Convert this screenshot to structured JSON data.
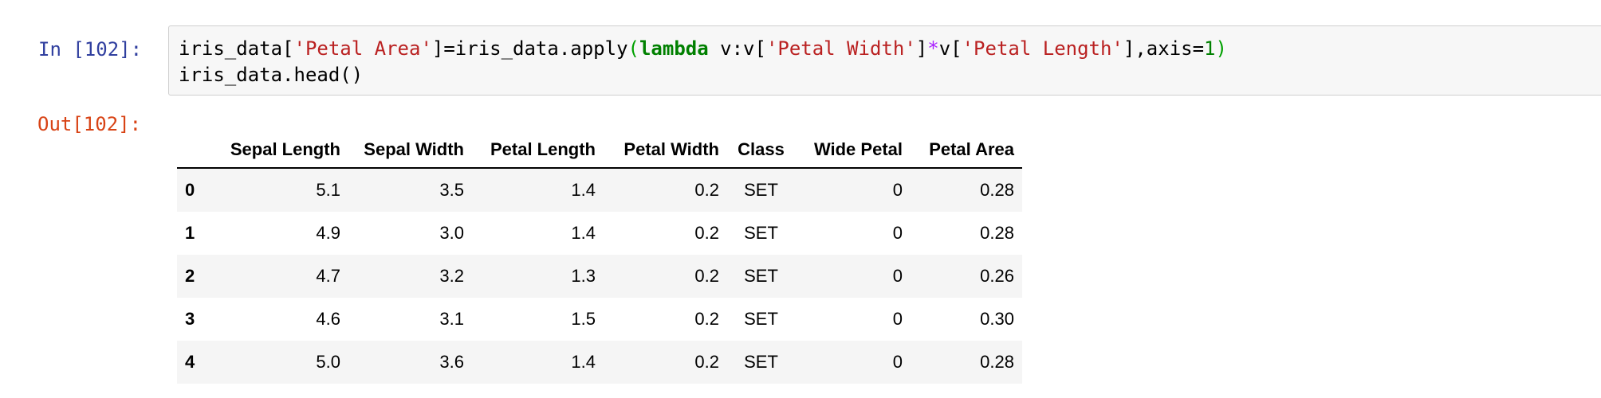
{
  "input_cell": {
    "prompt": "In [102]:",
    "code": {
      "line1": {
        "t1": "iris_data[",
        "s1": "'Petal Area'",
        "t2": "]=iris_data.apply",
        "p1": "(",
        "kw": "lambda",
        "t3": " v:v[",
        "s2": "'Petal Width'",
        "t4": "]",
        "op": "*",
        "t5": "v[",
        "s3": "'Petal Length'",
        "t6": "],axis=",
        "n1": "1",
        "p2": ")"
      },
      "line2": "iris_data.head()"
    }
  },
  "output_cell": {
    "prompt": "Out[102]:",
    "table": {
      "index_header": "",
      "columns": [
        "Sepal Length",
        "Sepal Width",
        "Petal Length",
        "Petal Width",
        "Class",
        "Wide Petal",
        "Petal Area"
      ],
      "rows": [
        {
          "index": "0",
          "values": [
            "5.1",
            "3.5",
            "1.4",
            "0.2",
            "SET",
            "0",
            "0.28"
          ]
        },
        {
          "index": "1",
          "values": [
            "4.9",
            "3.0",
            "1.4",
            "0.2",
            "SET",
            "0",
            "0.28"
          ]
        },
        {
          "index": "2",
          "values": [
            "4.7",
            "3.2",
            "1.3",
            "0.2",
            "SET",
            "0",
            "0.26"
          ]
        },
        {
          "index": "3",
          "values": [
            "4.6",
            "3.1",
            "1.5",
            "0.2",
            "SET",
            "0",
            "0.30"
          ]
        },
        {
          "index": "4",
          "values": [
            "5.0",
            "3.6",
            "1.4",
            "0.2",
            "SET",
            "0",
            "0.28"
          ]
        }
      ]
    }
  },
  "colors": {
    "in_prompt": "#303f9f",
    "out_prompt": "#d84315",
    "string": "#ba2121",
    "keyword": "#008000",
    "operator": "#aa22ff",
    "code_background": "#f7f7f7",
    "row_stripe": "#f5f5f5"
  }
}
